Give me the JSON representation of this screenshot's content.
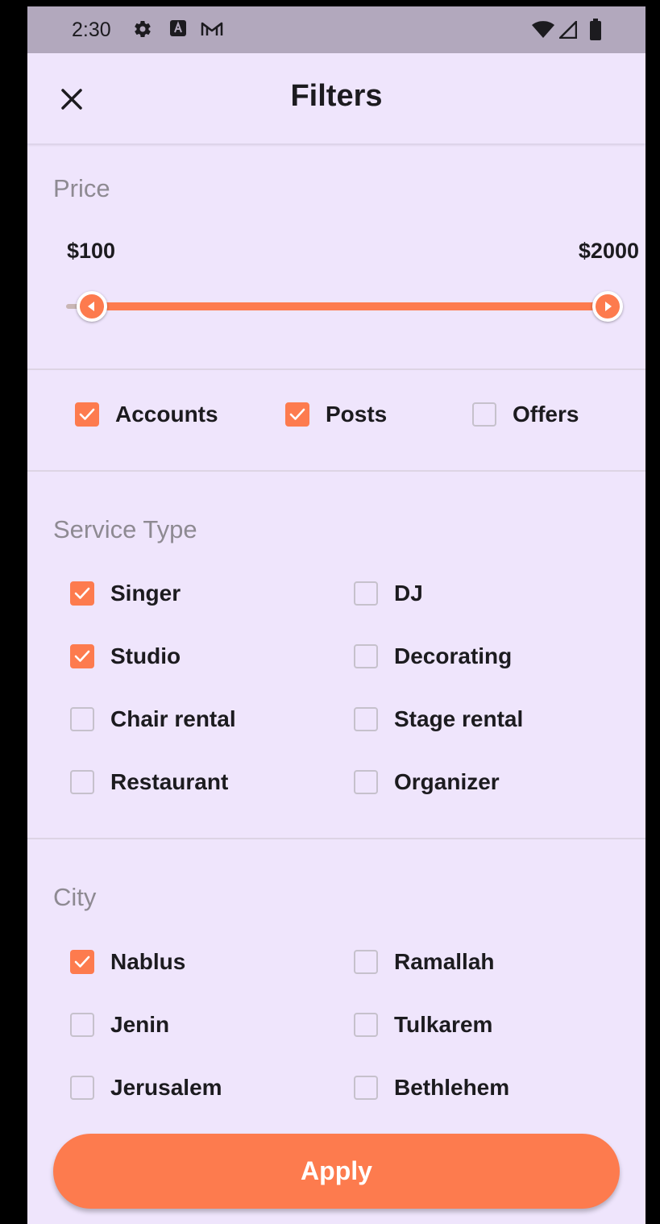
{
  "status_bar": {
    "time": "2:30",
    "icons": [
      "gear-icon",
      "a-notification-icon",
      "gmail-icon",
      "wifi-icon",
      "signal-icon",
      "battery-icon"
    ]
  },
  "header": {
    "title": "Filters",
    "close_icon": "close-icon"
  },
  "price": {
    "label": "Price",
    "min_label": "$100",
    "max_label": "$2000",
    "range_fraction": [
      0.05,
      1.0
    ]
  },
  "content_types": [
    {
      "label": "Accounts",
      "checked": true
    },
    {
      "label": "Posts",
      "checked": true
    },
    {
      "label": "Offers",
      "checked": false
    }
  ],
  "service_type": {
    "label": "Service Type",
    "options": [
      {
        "label": "Singer",
        "checked": true
      },
      {
        "label": "DJ",
        "checked": false
      },
      {
        "label": "Studio",
        "checked": true
      },
      {
        "label": "Decorating",
        "checked": false
      },
      {
        "label": "Chair rental",
        "checked": false
      },
      {
        "label": "Stage rental",
        "checked": false
      },
      {
        "label": "Restaurant",
        "checked": false
      },
      {
        "label": "Organizer",
        "checked": false
      }
    ]
  },
  "city": {
    "label": "City",
    "options": [
      {
        "label": "Nablus",
        "checked": true
      },
      {
        "label": "Ramallah",
        "checked": false
      },
      {
        "label": "Jenin",
        "checked": false
      },
      {
        "label": "Tulkarem",
        "checked": false
      },
      {
        "label": "Jerusalem",
        "checked": false
      },
      {
        "label": "Bethlehem",
        "checked": false
      }
    ]
  },
  "apply_label": "Apply",
  "colors": {
    "accent": "#fd7b4e",
    "background": "#efe5fc",
    "status_bar": "#b2a8bd",
    "text": "#1c1b1f",
    "muted_text": "#8e8a92"
  }
}
